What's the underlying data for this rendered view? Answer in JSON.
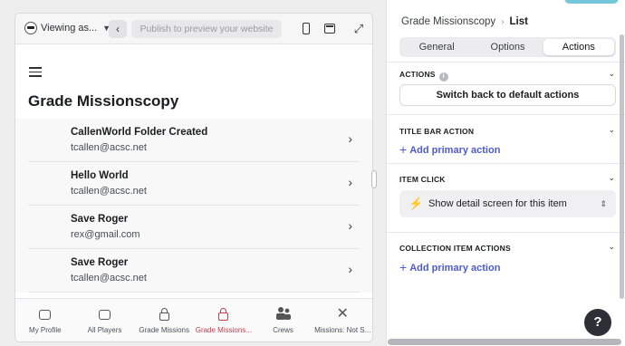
{
  "preview": {
    "viewing_as": "Viewing as...",
    "publish_placeholder": "Publish to preview your website",
    "screen_title": "Grade Missionscopy",
    "items": [
      {
        "title": "CallenWorld Folder Created",
        "subtitle": "tcallen@acsc.net"
      },
      {
        "title": "Hello World",
        "subtitle": "tcallen@acsc.net"
      },
      {
        "title": "Save Roger",
        "subtitle": "rex@gmail.com"
      },
      {
        "title": "Save Roger",
        "subtitle": "tcallen@acsc.net"
      }
    ],
    "tabs": [
      {
        "label": "My Profile",
        "icon": "message-icon"
      },
      {
        "label": "All Players",
        "icon": "message-icon"
      },
      {
        "label": "Grade Missions",
        "icon": "lock-icon"
      },
      {
        "label": "Grade Missions...",
        "icon": "lock-icon",
        "active": true
      },
      {
        "label": "Crews",
        "icon": "people-icon"
      },
      {
        "label": "Missions: Not S...",
        "icon": "close-icon"
      }
    ],
    "active_color": "#c43b4f"
  },
  "panel": {
    "breadcrumb": {
      "parent": "Grade Missionscopy",
      "current": "List"
    },
    "tabs": [
      "General",
      "Options",
      "Actions"
    ],
    "active_tab": "Actions",
    "actions": {
      "heading": "ACTIONS",
      "button": "Switch back to default actions"
    },
    "title_bar": {
      "heading": "TITLE BAR ACTION",
      "add": "Add primary action"
    },
    "item_click": {
      "heading": "ITEM CLICK",
      "value": "Show detail screen for this item"
    },
    "collection": {
      "heading": "COLLECTION ITEM ACTIONS",
      "add": "Add primary action"
    },
    "link_color": "#4e5ad1"
  },
  "help": "?"
}
